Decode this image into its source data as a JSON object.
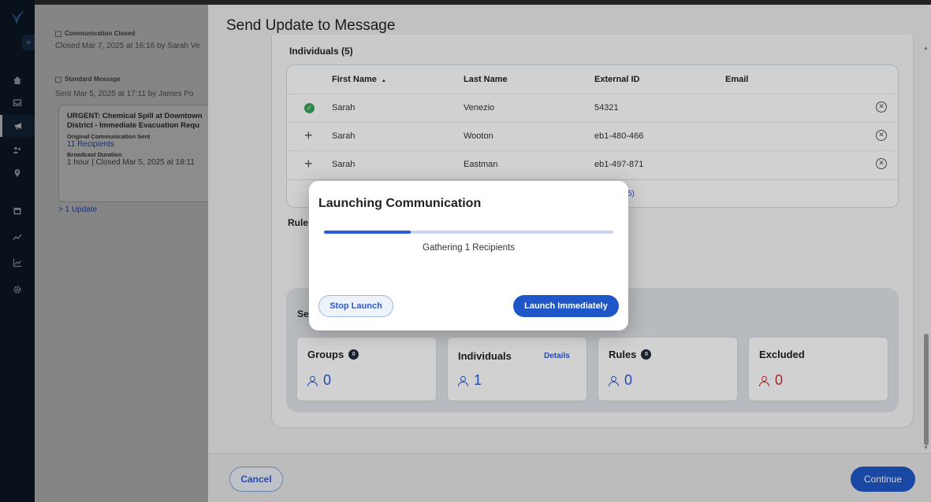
{
  "background_panel": {
    "closed_header": "Communication Closed",
    "closed_sub": "Closed Mar 7, 2025 at 16:16 by Sarah Ve",
    "standard_header": "Standard Message",
    "standard_sub": "Sent Mar 5, 2025 at 17:11 by James Po",
    "card_title_1": "URGENT: Chemical Spill at Downtown",
    "card_title_2": "District - Immediate Evacuation Requ",
    "original_label": "Original Communication Sent",
    "original_value": "11 Recipients",
    "duration_label": "Broadcast Duration",
    "duration_value": "1 hour | Closed Mar 5, 2025 at 18:11",
    "updates_link": "> 1 Update"
  },
  "drawer": {
    "title": "Send Update to Message",
    "individuals_title": "Individuals (5)",
    "columns": {
      "first_name": "First Name",
      "sort_indicator": "▲",
      "last_name": "Last Name",
      "external_id": "External ID",
      "email": "Email"
    },
    "rows": [
      {
        "status": "included",
        "first": "Sarah",
        "last": "Venezio",
        "external_id": "54321",
        "email": ""
      },
      {
        "status": "add",
        "first": "Sarah",
        "last": "Wooton",
        "external_id": "eb1-480-466",
        "email": ""
      },
      {
        "status": "add",
        "first": "Sarah",
        "last": "Eastman",
        "external_id": "eb1-497-871",
        "email": ""
      }
    ],
    "table_footer_partial": "5)",
    "rules_partial": "Rule",
    "summary_partial": "Se",
    "summary": {
      "groups": {
        "label": "Groups",
        "badge": "0",
        "value": "0"
      },
      "individuals": {
        "label": "Individuals",
        "details": "Details",
        "value": "1"
      },
      "rules": {
        "label": "Rules",
        "badge": "0",
        "value": "0"
      },
      "excluded": {
        "label": "Excluded",
        "value": "0"
      }
    },
    "cancel": "Cancel",
    "continue": "Continue"
  },
  "modal": {
    "title": "Launching Communication",
    "progress": 0.3,
    "status": "Gathering 1 Recipients",
    "stop_button": "Stop Launch",
    "launch_button": "Launch Immediately"
  },
  "icons": {
    "nav": [
      "home-icon",
      "inbox-icon",
      "megaphone-icon",
      "people-icon",
      "location-icon",
      "calendar-icon",
      "analytics-icon",
      "chart-icon",
      "settings-icon"
    ]
  },
  "colors": {
    "accent": "#1f57c8",
    "link": "#2a5bd7",
    "success": "#3aa35b",
    "danger": "#c53030",
    "nav_bg": "#0f1f33"
  }
}
